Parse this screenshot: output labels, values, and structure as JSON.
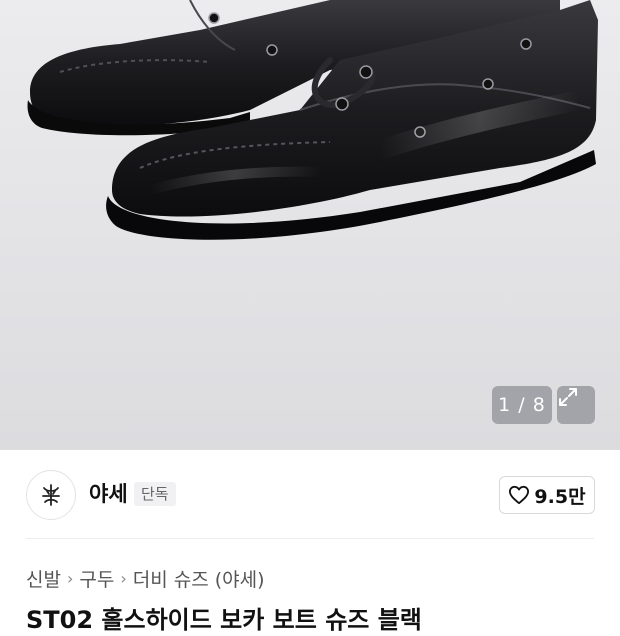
{
  "gallery": {
    "counter": "1 / 8",
    "expand_icon": "expand-arrows-icon"
  },
  "brand": {
    "logo_icon": "brand-logo-icon",
    "name": "야세",
    "badge": "단독"
  },
  "like": {
    "icon": "heart-outline-icon",
    "count": "9.5만"
  },
  "breadcrumb": {
    "items": [
      "신발",
      "구두",
      "더비 슈즈 (야세)"
    ]
  },
  "product": {
    "title": "ST02 홀스하이드 보카 보트 슈즈 블랙"
  },
  "colors": {
    "accent": "#111111",
    "hero_bg": "#e6e6e8"
  }
}
